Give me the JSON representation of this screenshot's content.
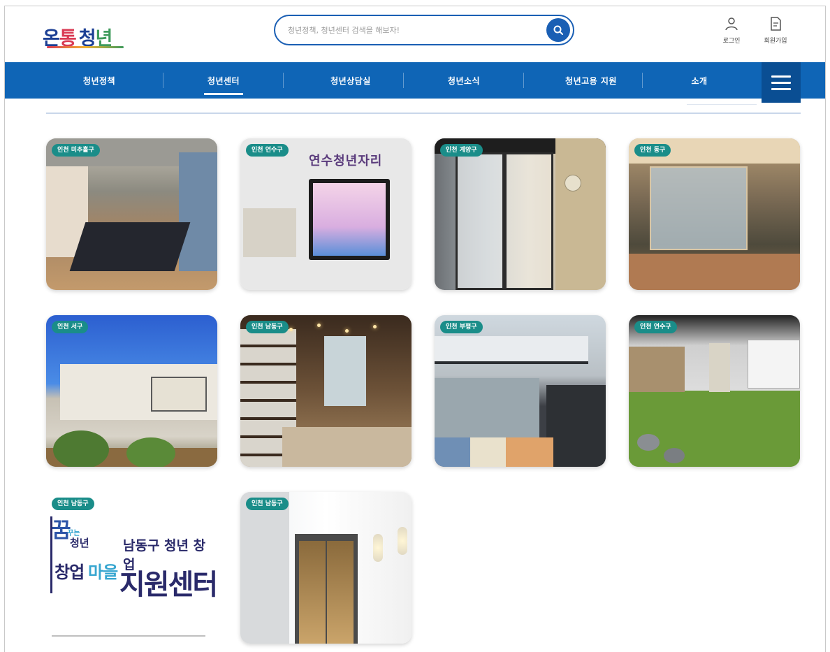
{
  "header": {
    "logo_parts": [
      "온",
      "통",
      "청",
      "년"
    ],
    "search_placeholder": "청년정책, 청년센터 검색을 해보자!",
    "login_label": "로그인",
    "signup_label": "회원가입"
  },
  "nav": {
    "items": [
      {
        "label": "청년정책"
      },
      {
        "label": "청년센터"
      },
      {
        "label": "청년상담실"
      },
      {
        "label": "청년소식"
      },
      {
        "label": "청년고용 지원"
      },
      {
        "label": "소개"
      }
    ],
    "active_index": 1
  },
  "colors": {
    "nav_bg": "#0f65b6",
    "badge_bg": "#1a8d89",
    "search_border": "#1a5fb4"
  },
  "icons": {
    "search": "search-icon",
    "login": "user-icon",
    "signup": "document-icon",
    "menu": "hamburger-icon"
  },
  "centers": [
    {
      "badge": "인천 미추홀구"
    },
    {
      "badge": "인천 연수구",
      "sign_text": "연수청년자리"
    },
    {
      "badge": "인천 계양구"
    },
    {
      "badge": "인천 동구"
    },
    {
      "badge": "인천 서구"
    },
    {
      "badge": "인천 남동구"
    },
    {
      "badge": "인천 부평구"
    },
    {
      "badge": "인천 연수구"
    },
    {
      "badge": "인천 남동구",
      "poster": {
        "ggum": "꿈",
        "small": "꾸는",
        "line1a": "청년",
        "line2a": "창업",
        "line2b": "마을",
        "right1": "남동구 청년 창업",
        "right2": "지원센터"
      }
    },
    {
      "badge": "인천 남동구"
    }
  ]
}
